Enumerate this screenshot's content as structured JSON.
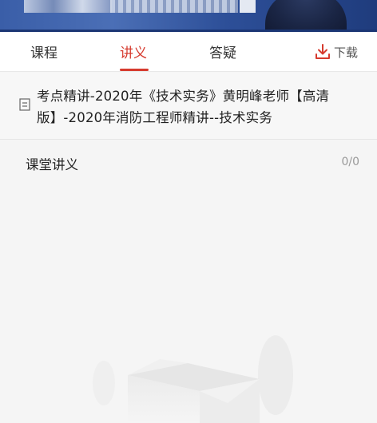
{
  "tabs": [
    {
      "label": "课程"
    },
    {
      "label": "讲义"
    },
    {
      "label": "答疑"
    }
  ],
  "download": {
    "label": "下载"
  },
  "course": {
    "title": "考点精讲-2020年《技术实务》黄明峰老师【高清版】-2020年消防工程师精讲--技术实务"
  },
  "section": {
    "label": "课堂讲义",
    "count": "0/0"
  },
  "colors": {
    "accent": "#d63a2e",
    "banner": "#3a5ea8"
  }
}
